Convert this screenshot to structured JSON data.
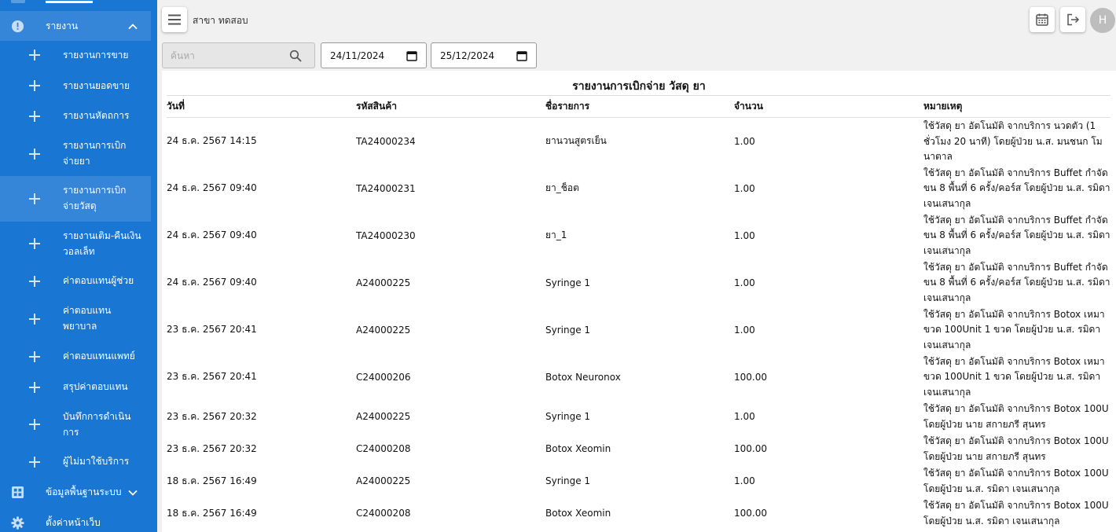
{
  "branch": "สาขา ทดสอบ",
  "avatar_letter": "H",
  "sidebar": {
    "report_group": {
      "label": "รายงาน",
      "icon": "alert-circle-icon"
    },
    "items": [
      {
        "label": "รายงานการขาย"
      },
      {
        "label": "รายงานยอดขาย"
      },
      {
        "label": "รายงานหัตถการ"
      },
      {
        "label": "รายงานการเบิกจ่ายยา"
      },
      {
        "label": "รายงานการเบิกจ่ายวัสดุ"
      },
      {
        "label": "รายงานเติม-คืนเงินวอลเล็ท"
      },
      {
        "label": "ค่าตอบแทนผู้ช่วย"
      },
      {
        "label": "ค่าตอบแทนพยาบาล"
      },
      {
        "label": "ค่าตอบแทนแพทย์"
      },
      {
        "label": "สรุปค่าตอบแทน"
      },
      {
        "label": "บันทึกการดำเนินการ"
      },
      {
        "label": "ผู้ไม่มาใช้บริการ"
      }
    ],
    "master_data": {
      "label": "ข้อมูลพื้นฐานระบบ",
      "icon": "grid-icon"
    },
    "web_settings": {
      "label": "ตั้งค่าหน้าเว็บ",
      "icon": "gear-icon"
    }
  },
  "filters": {
    "search_placeholder": "ค้นหา",
    "date_from": "24/11/2024",
    "date_to": "25/12/2024"
  },
  "report": {
    "title": "รายงานการเบิกจ่าย วัสดุ ยา",
    "columns": [
      "วันที่",
      "รหัสสินค้า",
      "ชื่อรายการ",
      "จำนวน",
      "หมายเหตุ"
    ],
    "rows": [
      [
        "24 ธ.ค. 2567 14:15",
        "TA24000234",
        "ยานวนสูตรเย็น",
        "1.00",
        "ใช้วัสดุ ยา อัตโนมัติ จากบริการ นวดตัว (1 ชั่วโมง 20 นาที) โดยผู้ป่วย น.ส. มนชนก โมนาตาล"
      ],
      [
        "24 ธ.ค. 2567 09:40",
        "TA24000231",
        "ยา_ช็อต",
        "1.00",
        "ใช้วัสดุ ยา อัตโนมัติ จากบริการ Buffet กำจัดขน 8 พื้นที่ 6 ครั้ง/คอร์ส โดยผู้ป่วย น.ส. รมิดา เจนเสนากุล"
      ],
      [
        "24 ธ.ค. 2567 09:40",
        "TA24000230",
        "ยา_1",
        "1.00",
        "ใช้วัสดุ ยา อัตโนมัติ จากบริการ Buffet กำจัดขน 8 พื้นที่ 6 ครั้ง/คอร์ส โดยผู้ป่วย น.ส. รมิดา เจนเสนากุล"
      ],
      [
        "24 ธ.ค. 2567 09:40",
        "A24000225",
        "Syringe 1",
        "1.00",
        "ใช้วัสดุ ยา อัตโนมัติ จากบริการ Buffet กำจัดขน 8 พื้นที่ 6 ครั้ง/คอร์ส โดยผู้ป่วย น.ส. รมิดา เจนเสนากุล"
      ],
      [
        "23 ธ.ค. 2567 20:41",
        "A24000225",
        "Syringe 1",
        "1.00",
        "ใช้วัสดุ ยา อัตโนมัติ จากบริการ Botox เหมาขวด 100Unit 1 ขวด โดยผู้ป่วย น.ส. รมิดา เจนเสนากุล"
      ],
      [
        "23 ธ.ค. 2567 20:41",
        "C24000206",
        "Botox Neuronox",
        "100.00",
        "ใช้วัสดุ ยา อัตโนมัติ จากบริการ Botox เหมาขวด 100Unit 1 ขวด โดยผู้ป่วย น.ส. รมิดา เจนเสนากุล"
      ],
      [
        "23 ธ.ค. 2567 20:32",
        "A24000225",
        "Syringe 1",
        "1.00",
        "ใช้วัสดุ ยา อัตโนมัติ จากบริการ Botox 100U โดยผู้ป่วย นาย สกายภรี สุนทร"
      ],
      [
        "23 ธ.ค. 2567 20:32",
        "C24000208",
        "Botox Xeomin",
        "100.00",
        "ใช้วัสดุ ยา อัตโนมัติ จากบริการ Botox 100U โดยผู้ป่วย นาย สกายภรี สุนทร"
      ],
      [
        "18 ธ.ค. 2567 16:49",
        "A24000225",
        "Syringe 1",
        "1.00",
        "ใช้วัสดุ ยา อัตโนมัติ จากบริการ Botox 100U โดยผู้ป่วย น.ส. รมิดา เจนเสนากุล"
      ],
      [
        "18 ธ.ค. 2567 16:49",
        "C24000208",
        "Botox Xeomin",
        "100.00",
        "ใช้วัสดุ ยา อัตโนมัติ จากบริการ Botox 100U โดยผู้ป่วย น.ส. รมิดา เจนเสนากุล"
      ]
    ]
  },
  "colors": {
    "sidebar": "#1976d2",
    "sidebar_active": "#3585d8",
    "page_bg": "#f1f1f1"
  }
}
